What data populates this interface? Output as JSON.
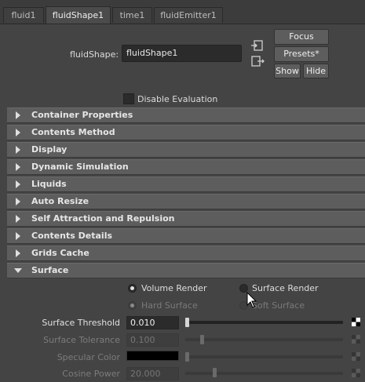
{
  "tabs": [
    {
      "label": "fluid1"
    },
    {
      "label": "fluidShape1"
    },
    {
      "label": "time1"
    },
    {
      "label": "fluidEmitter1"
    }
  ],
  "active_tab": "fluidShape1",
  "header": {
    "node_label": "fluidShape:",
    "node_value": "fluidShape1",
    "focus_label": "Focus",
    "presets_label": "Presets*",
    "show_label": "Show",
    "hide_label": "Hide",
    "disable_eval_label": "Disable Evaluation",
    "disable_eval_checked": false
  },
  "frames": [
    {
      "title": "Container Properties",
      "expanded": false
    },
    {
      "title": "Contents Method",
      "expanded": false
    },
    {
      "title": "Display",
      "expanded": false
    },
    {
      "title": "Dynamic Simulation",
      "expanded": false
    },
    {
      "title": "Liquids",
      "expanded": false
    },
    {
      "title": "Auto Resize",
      "expanded": false
    },
    {
      "title": "Self Attraction and Repulsion",
      "expanded": false
    },
    {
      "title": "Contents Details",
      "expanded": false
    },
    {
      "title": "Grids Cache",
      "expanded": false
    },
    {
      "title": "Surface",
      "expanded": true
    }
  ],
  "surface": {
    "render_mode": {
      "volume_label": "Volume Render",
      "surface_label": "Surface Render",
      "selected": "Volume Render"
    },
    "surface_type": {
      "hard_label": "Hard Surface",
      "soft_label": "Soft Surface",
      "selected": "Hard Surface",
      "enabled": false
    },
    "attributes": [
      {
        "label": "Surface Threshold",
        "value": "0.010",
        "slider": 0.0,
        "enabled": true
      },
      {
        "label": "Surface Tolerance",
        "value": "0.100",
        "slider": 0.1,
        "enabled": false
      },
      {
        "label": "Specular Color",
        "value": "",
        "color": "#000000",
        "slider": 0.0,
        "enabled": false
      },
      {
        "label": "Cosine Power",
        "value": "20.000",
        "slider": 0.18,
        "enabled": false
      }
    ]
  },
  "colors": {
    "background": "#444444",
    "frame_header": "#5d5d5d",
    "field": "#2b2b2b"
  }
}
